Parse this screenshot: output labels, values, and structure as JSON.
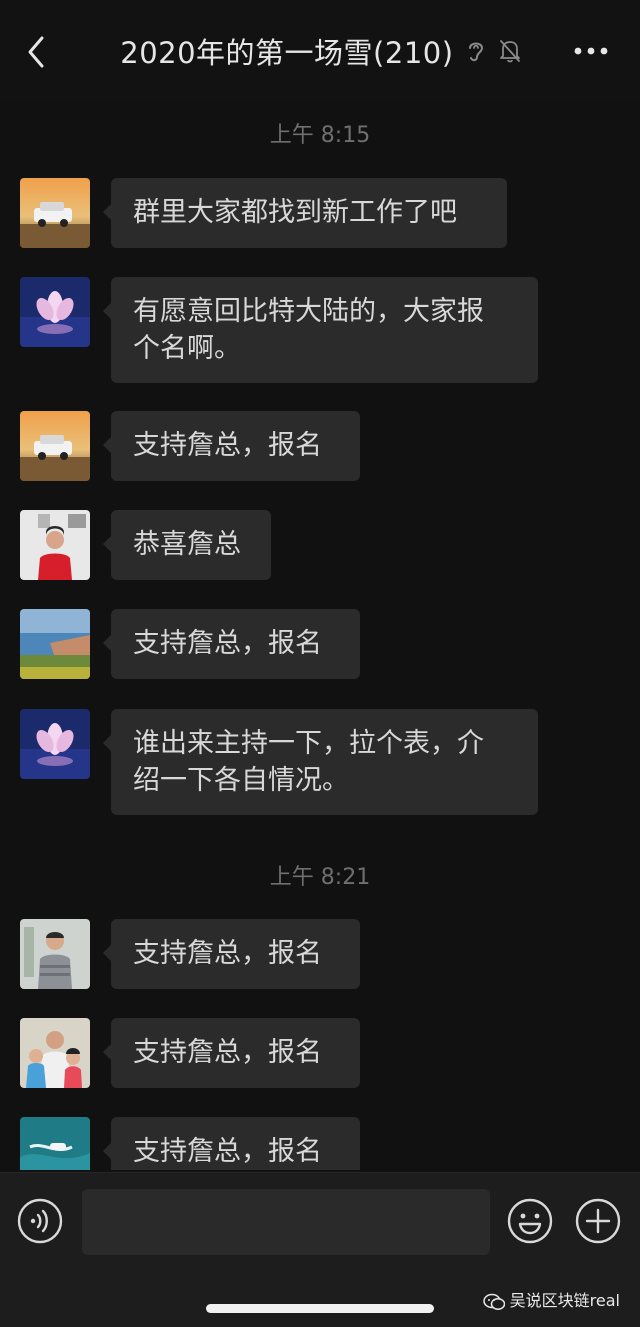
{
  "header": {
    "title": "2020年的第一场雪(210)",
    "icons": [
      "back-chevron-icon",
      "ear-icon",
      "mute-bell-icon",
      "more-dots-icon"
    ]
  },
  "chat": {
    "timestamps": [
      "上午 8:15",
      "上午 8:21"
    ],
    "messages": [
      {
        "avatar": "avatar-car-sunset",
        "text": "群里大家都找到新工作了吧"
      },
      {
        "avatar": "avatar-lotus",
        "text": "有愿意回比特大陆的，大家报\n个名啊。"
      },
      {
        "avatar": "avatar-car-sunset",
        "text": "支持詹总，报名"
      },
      {
        "avatar": "avatar-woman-red",
        "text": "恭喜詹总"
      },
      {
        "avatar": "avatar-coast",
        "text": "支持詹总，报名"
      },
      {
        "avatar": "avatar-lotus",
        "text": "谁出来主持一下，拉个表，介\n绍一下各自情况。"
      },
      {
        "avatar": "avatar-man-portrait",
        "text": "支持詹总，报名"
      },
      {
        "avatar": "avatar-family",
        "text": "支持詹总，报名"
      },
      {
        "avatar": "avatar-jetski",
        "text": "支持詹总，报名"
      }
    ]
  },
  "input_bar": {
    "value": "",
    "icons": [
      "voice-icon",
      "emoji-icon",
      "plus-icon"
    ]
  },
  "watermark": {
    "text": "吴说区块链real"
  },
  "colors": {
    "background": "#111111",
    "bubble": "#2b2b2b",
    "timestamp": "#6f6f6f",
    "text": "#d8d8d8"
  }
}
